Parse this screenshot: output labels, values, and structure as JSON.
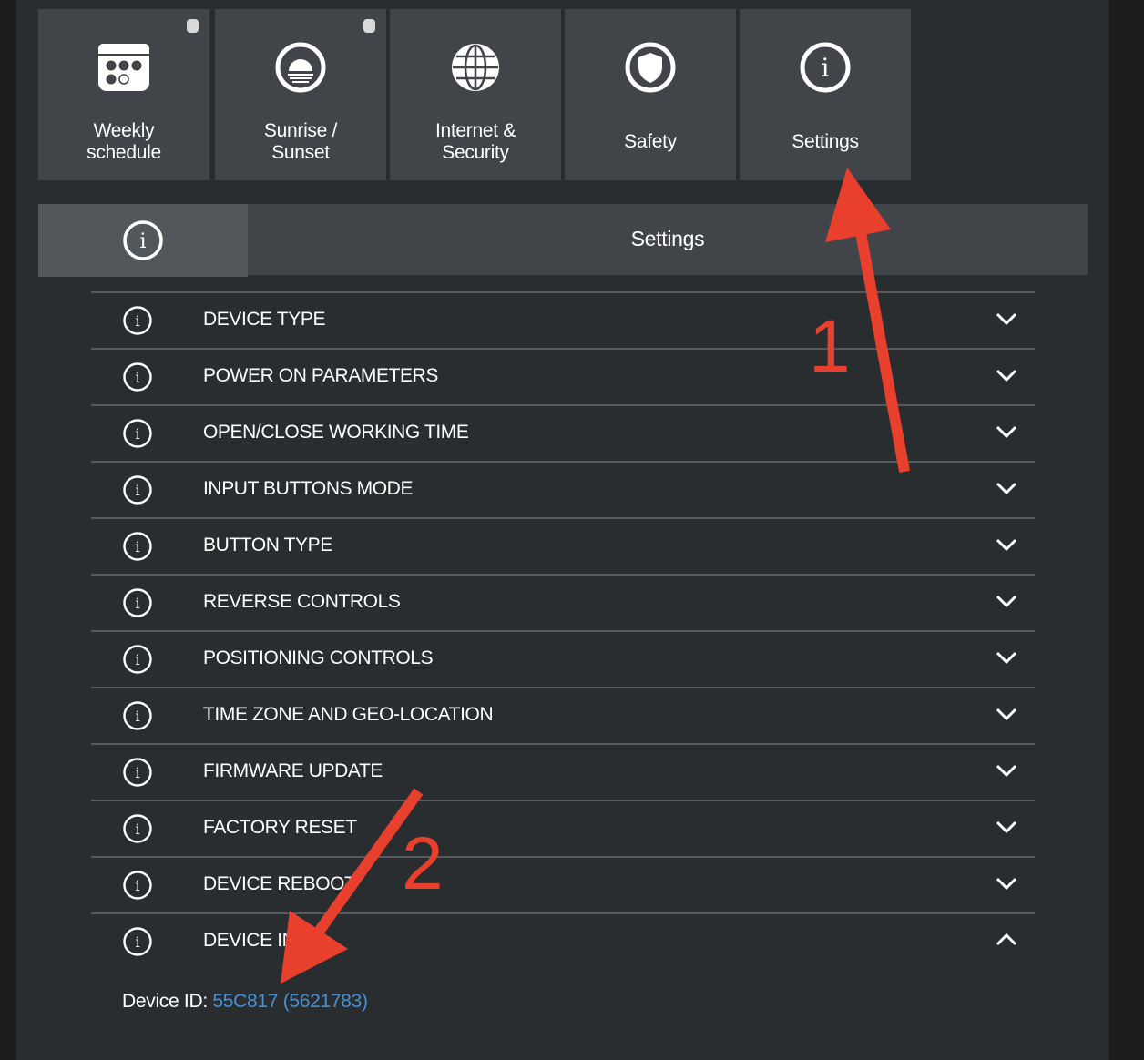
{
  "tiles": [
    {
      "label": "Weekly\nschedule",
      "icon": "calendar-icon",
      "has_dot": true
    },
    {
      "label": "Sunrise /\nSunset",
      "icon": "sunrise-icon",
      "has_dot": true
    },
    {
      "label": "Internet &\nSecurity",
      "icon": "globe-icon",
      "has_dot": false
    },
    {
      "label": "Safety",
      "icon": "shield-icon",
      "has_dot": false
    },
    {
      "label": "Settings",
      "icon": "info-icon",
      "has_dot": false
    }
  ],
  "header": {
    "title": "Settings",
    "icon": "info-icon"
  },
  "rows": [
    {
      "label": "DEVICE TYPE",
      "expanded": false
    },
    {
      "label": "POWER ON PARAMETERS",
      "expanded": false
    },
    {
      "label": "OPEN/CLOSE WORKING TIME",
      "expanded": false
    },
    {
      "label": "INPUT BUTTONS MODE",
      "expanded": false
    },
    {
      "label": "BUTTON TYPE",
      "expanded": false
    },
    {
      "label": "REVERSE CONTROLS",
      "expanded": false
    },
    {
      "label": "POSITIONING CONTROLS",
      "expanded": false
    },
    {
      "label": "TIME ZONE AND GEO-LOCATION",
      "expanded": false
    },
    {
      "label": "FIRMWARE UPDATE",
      "expanded": false
    },
    {
      "label": "FACTORY RESET",
      "expanded": false
    },
    {
      "label": "DEVICE REBOOT",
      "expanded": false
    },
    {
      "label": "DEVICE INFO",
      "expanded": true
    }
  ],
  "device_info": {
    "label": "Device ID:",
    "value": "55C817 (5621783)"
  },
  "annotations": {
    "step1": "1",
    "step2": "2",
    "arrow_color": "#e8402c"
  },
  "colors": {
    "link": "#4a90d0",
    "tile_bg": "#41454a",
    "panel_bg": "#292d30"
  }
}
